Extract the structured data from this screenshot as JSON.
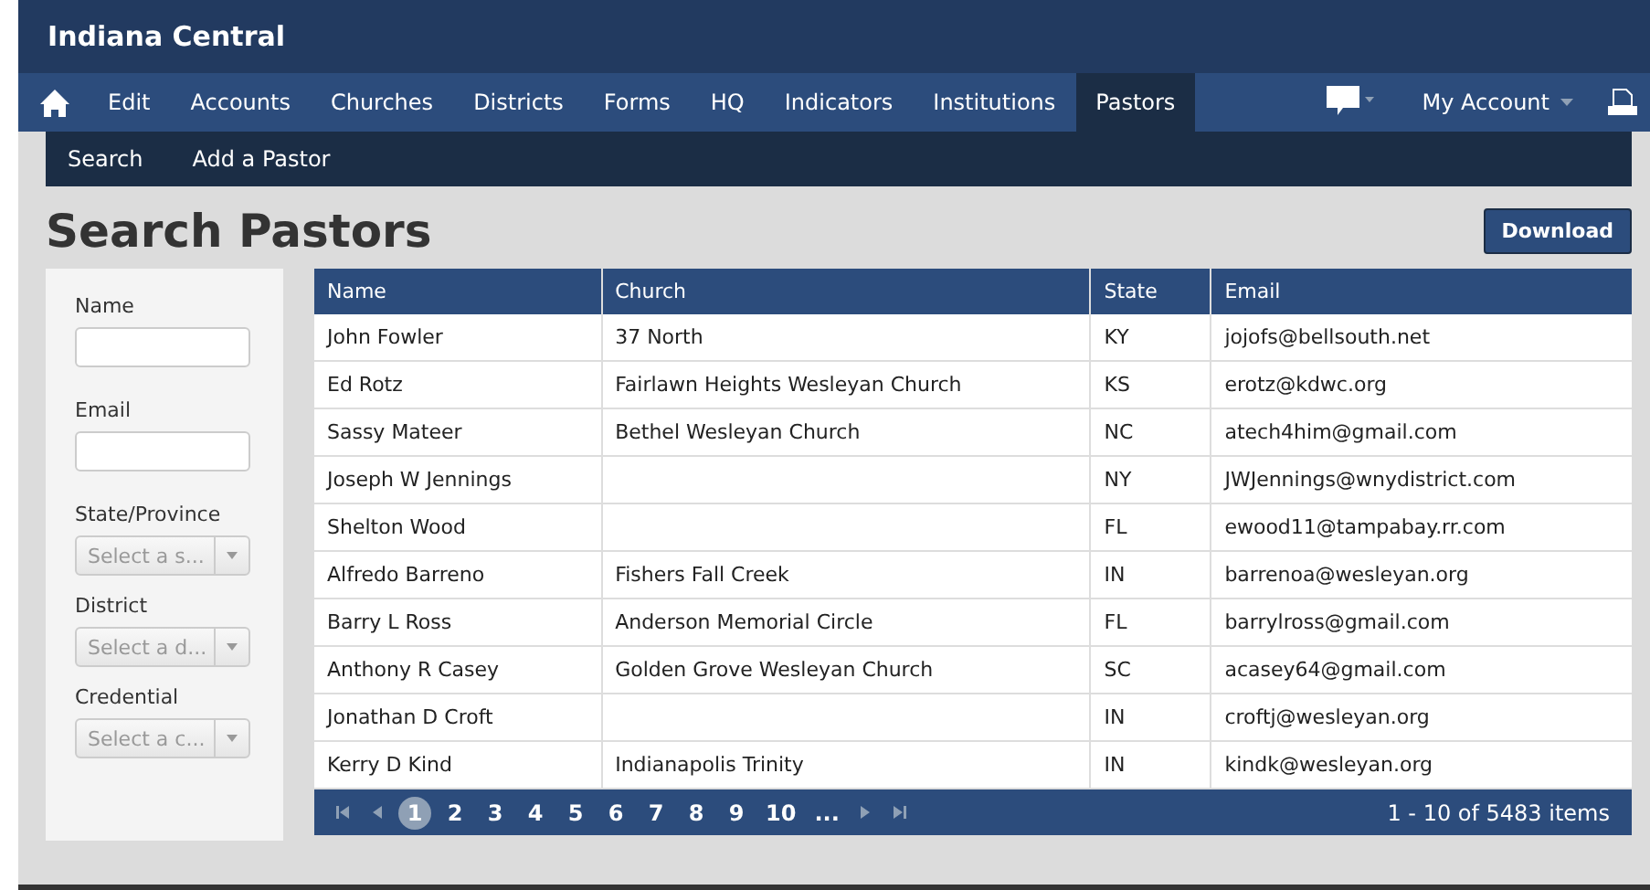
{
  "site_title": "Indiana Central",
  "nav": [
    {
      "label": "Edit",
      "selected": false
    },
    {
      "label": "Accounts",
      "selected": false
    },
    {
      "label": "Churches",
      "selected": false
    },
    {
      "label": "Districts",
      "selected": false
    },
    {
      "label": "Forms",
      "selected": false
    },
    {
      "label": "HQ",
      "selected": false
    },
    {
      "label": "Indicators",
      "selected": false
    },
    {
      "label": "Institutions",
      "selected": false
    },
    {
      "label": "Pastors",
      "selected": true
    }
  ],
  "account_menu": "My Account",
  "subnav": [
    "Search",
    "Add a Pastor"
  ],
  "page_title": "Search Pastors",
  "download_button": "Download",
  "filters": [
    {
      "kind": "text",
      "label": "Name"
    },
    {
      "kind": "text",
      "label": "Email"
    },
    {
      "kind": "select",
      "label": "State/Province",
      "placeholder": "Select a s..."
    },
    {
      "kind": "select",
      "label": "District",
      "placeholder": "Select a d..."
    },
    {
      "kind": "select",
      "label": "Credential",
      "placeholder": "Select a c..."
    }
  ],
  "table": {
    "columns": [
      "Name",
      "Church",
      "State",
      "Email"
    ],
    "rows": [
      [
        "John Fowler",
        "37 North",
        "KY",
        "jojofs@bellsouth.net"
      ],
      [
        "Ed Rotz",
        "Fairlawn Heights Wesleyan Church",
        "KS",
        "erotz@kdwc.org"
      ],
      [
        "Sassy Mateer",
        "Bethel Wesleyan Church",
        "NC",
        "atech4him@gmail.com"
      ],
      [
        "Joseph W Jennings",
        "",
        "NY",
        "JWJennings@wnydistrict.com"
      ],
      [
        "Shelton Wood",
        "",
        "FL",
        "ewood11@tampabay.rr.com"
      ],
      [
        "Alfredo Barreno",
        "Fishers Fall Creek",
        "IN",
        "barrenoa@wesleyan.org"
      ],
      [
        "Barry L Ross",
        "Anderson Memorial Circle",
        "FL",
        "barrylross@gmail.com"
      ],
      [
        "Anthony R Casey",
        "Golden Grove Wesleyan Church",
        "SC",
        "acasey64@gmail.com"
      ],
      [
        "Jonathan D Croft",
        "",
        "IN",
        "croftj@wesleyan.org"
      ],
      [
        "Kerry D Kind",
        "Indianapolis Trinity",
        "IN",
        "kindk@wesleyan.org"
      ]
    ]
  },
  "pager": {
    "pages": [
      {
        "label": "1",
        "selected": true
      },
      {
        "label": "2",
        "selected": false
      },
      {
        "label": "3",
        "selected": false
      },
      {
        "label": "4",
        "selected": false
      },
      {
        "label": "5",
        "selected": false
      },
      {
        "label": "6",
        "selected": false
      },
      {
        "label": "7",
        "selected": false
      },
      {
        "label": "8",
        "selected": false
      },
      {
        "label": "9",
        "selected": false
      },
      {
        "label": "10",
        "selected": false
      },
      {
        "label": "...",
        "selected": false
      }
    ],
    "summary": "1 - 10 of 5483 items"
  }
}
